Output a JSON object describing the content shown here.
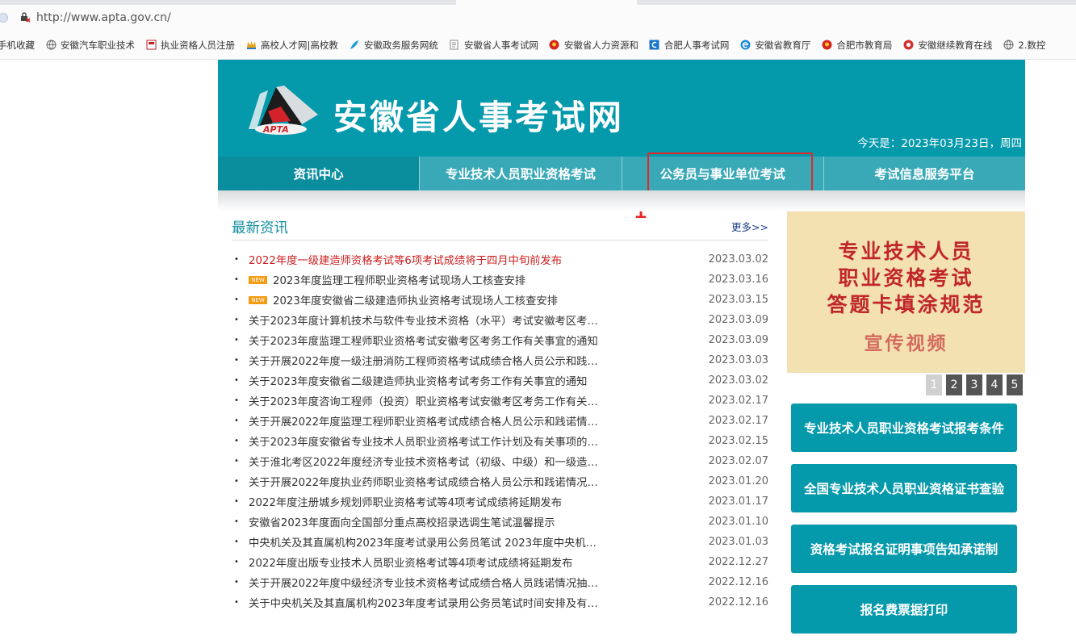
{
  "browser": {
    "url": "http://www.apta.gov.cn/",
    "bookmarks": [
      {
        "label": "手机收藏",
        "icon": "none"
      },
      {
        "label": "安徽汽车职业技术",
        "icon": "globe-icon"
      },
      {
        "label": "执业资格人员注册",
        "icon": "doc-red-icon"
      },
      {
        "label": "高校人才网|高校教",
        "icon": "crown-icon"
      },
      {
        "label": "安徽政务服务网统",
        "icon": "feather-icon"
      },
      {
        "label": "安徽省人事考试网",
        "icon": "page-icon"
      },
      {
        "label": "安徽省人力资源和",
        "icon": "emblem-icon"
      },
      {
        "label": "合肥人事考试网",
        "icon": "blue-c-icon"
      },
      {
        "label": "安徽省教育厅",
        "icon": "e-icon"
      },
      {
        "label": "合肥市教育局",
        "icon": "emblem-icon"
      },
      {
        "label": "安徽继续教育在线",
        "icon": "red-circle-icon"
      },
      {
        "label": "2.数控",
        "icon": "globe-icon"
      }
    ]
  },
  "site": {
    "title": "安徽省人事考试网",
    "logo_text": "APTA",
    "date": "今天是：2023年03月23日，周四"
  },
  "nav": [
    {
      "label": "资讯中心"
    },
    {
      "label": "专业技术人员职业资格考试"
    },
    {
      "label": "公务员与事业单位考试"
    },
    {
      "label": "考试信息服务平台"
    }
  ],
  "annotation": {
    "number": "1"
  },
  "news": {
    "title": "最新资讯",
    "more": "更多>>",
    "new_tag": "NEW",
    "items": [
      {
        "title": "2022年度一级建造师资格考试等6项考试成绩将于四月中旬前发布",
        "date": "2023.03.02",
        "red": true,
        "new": false
      },
      {
        "title": "2023年度监理工程师职业资格考试现场人工核查安排",
        "date": "2023.03.16",
        "red": false,
        "new": true
      },
      {
        "title": "2023年度安徽省二级建造师执业资格考试现场人工核查安排",
        "date": "2023.03.15",
        "red": false,
        "new": true
      },
      {
        "title": "关于2023年度计算机技术与软件专业技术资格（水平）考试安徽考区考…",
        "date": "2023.03.09",
        "red": false,
        "new": false
      },
      {
        "title": "关于2023年度监理工程师职业资格考试安徽考区考务工作有关事宜的通知",
        "date": "2023.03.09",
        "red": false,
        "new": false
      },
      {
        "title": "关于开展2022年度一级注册消防工程师资格考试成绩合格人员公示和践…",
        "date": "2023.03.03",
        "red": false,
        "new": false
      },
      {
        "title": "关于2023年度安徽省二级建造师执业资格考试考务工作有关事宜的通知",
        "date": "2023.03.02",
        "red": false,
        "new": false
      },
      {
        "title": "关于2023年度咨询工程师（投资）职业资格考试安徽考区考务工作有关…",
        "date": "2023.02.17",
        "red": false,
        "new": false
      },
      {
        "title": "关于开展2022年度监理工程师职业资格考试成绩合格人员公示和践诺情…",
        "date": "2023.02.17",
        "red": false,
        "new": false
      },
      {
        "title": "关于2023年度安徽省专业技术人员职业资格考试工作计划及有关事项的…",
        "date": "2023.02.15",
        "red": false,
        "new": false
      },
      {
        "title": "关于淮北考区2022年度经济专业技术资格考试（初级、中级）和一级造…",
        "date": "2023.02.07",
        "red": false,
        "new": false
      },
      {
        "title": "关于开展2022年度执业药师职业资格考试成绩合格人员公示和践诺情况…",
        "date": "2023.01.20",
        "red": false,
        "new": false
      },
      {
        "title": "2022年度注册城乡规划师职业资格考试等4项考试成绩将延期发布",
        "date": "2023.01.17",
        "red": false,
        "new": false
      },
      {
        "title": "安徽省2023年度面向全国部分重点高校招录选调生笔试温馨提示",
        "date": "2023.01.10",
        "red": false,
        "new": false
      },
      {
        "title": "中央机关及其直属机构2023年度考试录用公务员笔试 2023年度中央机…",
        "date": "2023.01.03",
        "red": false,
        "new": false
      },
      {
        "title": "2022年度出版专业技术人员职业资格考试等4项考试成绩将延期发布",
        "date": "2022.12.27",
        "red": false,
        "new": false
      },
      {
        "title": "关于开展2022年度中级经济专业技术资格考试成绩合格人员践诺情况抽…",
        "date": "2022.12.16",
        "red": false,
        "new": false
      },
      {
        "title": "关于中央机关及其直属机构2023年度考试录用公务员笔试时间安排及有…",
        "date": "2022.12.16",
        "red": false,
        "new": false
      }
    ]
  },
  "banner": {
    "line1": "专业技术人员",
    "line2": "职业资格考试",
    "line3": "答题卡填涂规范",
    "line4": "宣传视频",
    "pages": [
      "1",
      "2",
      "3",
      "4",
      "5"
    ],
    "current_page": "1"
  },
  "side_buttons": [
    {
      "label": "专业技术人员职业资格考试报考条件"
    },
    {
      "label": "全国专业技术人员职业资格证书查验"
    },
    {
      "label": "资格考试报名证明事项告知承诺制"
    },
    {
      "label": "报名费票据打印"
    }
  ],
  "colors": {
    "brand": "#0599ac",
    "nav": "#3aa9b7",
    "highlight": "#e62626",
    "news_title": "#1690a1"
  }
}
